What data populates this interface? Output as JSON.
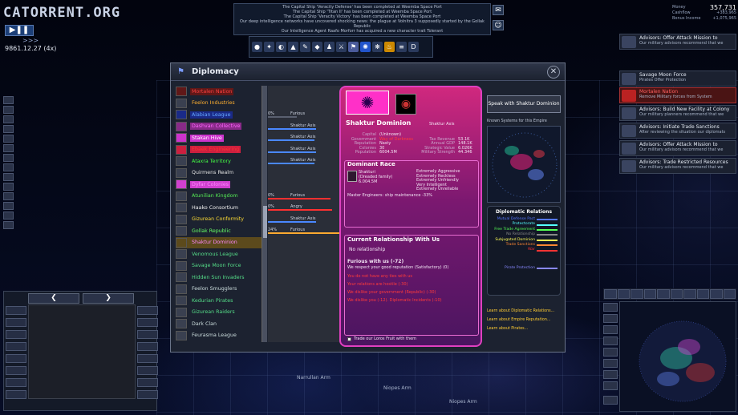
{
  "app": {
    "logo": "CATORRENT.ORG",
    "play_pause": "▶❚❚",
    "speed_arrows": ">>>",
    "game_date": "9861.12.27 (4x)"
  },
  "messages": [
    "The Capital Ship 'Veracity Defense' has been completed at Weemba Space Port",
    "The Capital Ship 'Titan II' has been completed at Weemba Space Port",
    "The Capital Ship 'Veracity Victory' has been completed at Weemba Space Port",
    "Our deep intelligence networks have uncovered shocking news: the plague at Volnitra 3 supposedly started by the Gollak Republic",
    "Our Intelligence Agent Raafo Morforr has acquired a new character trait Tolerant"
  ],
  "top_stats": {
    "money_label": "Money",
    "money": "357,731",
    "cashflow_label": "Cashflow",
    "cashflow": "+383,965",
    "bonus_label": "Bonus Income",
    "bonus": "+1,075,965"
  },
  "advisors": [
    {
      "title": "Advisors: Offer Attack Mission to",
      "sub": "Our military advisors recommend that we",
      "red": false
    },
    {
      "title": "Savage Moon Force",
      "sub": "Pirates Offer Protection",
      "red": false
    },
    {
      "title": "Mortalen Nation",
      "sub": "Remove Military forces from System",
      "red": true
    },
    {
      "title": "Advisors: Build New Facility at Colony",
      "sub": "Our military planners recommend that we",
      "red": false
    },
    {
      "title": "Advisors: Initiate Trade Sanctions",
      "sub": "After reviewing the situation our diplomats",
      "red": false
    },
    {
      "title": "Advisors: Offer Attack Mission to",
      "sub": "Our military advisors recommend that we",
      "red": false
    },
    {
      "title": "Advisors: Trade Restricted Resources",
      "sub": "Our military advisors recommend that we",
      "red": false
    }
  ],
  "dialog": {
    "title": "Diplomacy",
    "close_icon": "close-icon"
  },
  "empires": [
    {
      "name": "Mortalen Nation",
      "color": "#ff4040",
      "bg": "#601818"
    },
    {
      "name": "Feelon Industries",
      "color": "#ffb030",
      "bg": ""
    },
    {
      "name": "Alabian League",
      "color": "#66aaff",
      "bg": "#1a2a88"
    },
    {
      "name": "Dashvan Collective",
      "color": "#ff66ff",
      "bg": "#882a88"
    },
    {
      "name": "Stakan Hive",
      "color": "#ffffff",
      "bg": "#cc33cc"
    },
    {
      "name": "Ebaek Engineering",
      "color": "#ff3333",
      "bg": "#cc1f3f"
    },
    {
      "name": "Ataxra Territory",
      "color": "#44ff44",
      "bg": ""
    },
    {
      "name": "Quirmens Realm",
      "color": "#e0e0e0",
      "bg": ""
    },
    {
      "name": "Dyfar Colonies",
      "color": "#ff88ff",
      "bg": "#d040d0"
    },
    {
      "name": "Atunilian Kingdom",
      "color": "#55ee55",
      "bg": ""
    },
    {
      "name": "Haako Consortium",
      "color": "#f0f0f0",
      "bg": ""
    },
    {
      "name": "Gizurean Conformity",
      "color": "#ffdd33",
      "bg": ""
    },
    {
      "name": "Gollak Republic",
      "color": "#66ff66",
      "bg": ""
    },
    {
      "name": "Shaktur Dominion",
      "color": "#ff88ff",
      "bg": "#5c4a1c"
    },
    {
      "name": "Venomous League",
      "color": "#55dd88",
      "bg": ""
    },
    {
      "name": "Savage Moon Force",
      "color": "#55dd88",
      "bg": ""
    },
    {
      "name": "Hidden Sun Invaders",
      "color": "#55dd88",
      "bg": ""
    },
    {
      "name": "Feelon Smugglers",
      "color": "#ccdddd",
      "bg": ""
    },
    {
      "name": "Kedurian Pirates",
      "color": "#55dd88",
      "bg": ""
    },
    {
      "name": "Gizurean Raiders",
      "color": "#55dd88",
      "bg": ""
    },
    {
      "name": "Dark Clan",
      "color": "#ccdddd",
      "bg": ""
    },
    {
      "name": "Feurasma League",
      "color": "#ccdddd",
      "bg": ""
    }
  ],
  "relations_col": [
    {
      "label": "Furious",
      "value": "0%",
      "bar": "#5a6070"
    },
    {
      "label": "Shaktur Axis",
      "value": "",
      "bar": "#4a88ff"
    },
    {
      "label": "Shaktur Axis",
      "value": "",
      "bar": "#4a88ff"
    },
    {
      "label": "Shaktur Axis",
      "value": "",
      "bar": "#4a88ff"
    },
    {
      "label": "Shaktur Axis",
      "value": "",
      "bar": "#4a88ff"
    },
    {
      "label": "Furious",
      "value": "0%",
      "bar": "#ff3030"
    },
    {
      "label": "Angry",
      "value": "0%",
      "bar": "#ff3030"
    },
    {
      "label": "Shaktur Axis",
      "value": "",
      "bar": "#4a88ff"
    },
    {
      "label": "Furious",
      "value": "24%",
      "bar": "#ffaa30"
    }
  ],
  "selected": {
    "name": "Shaktur Dominion",
    "axis": "Shaktur Axis",
    "capital_label": "Capital",
    "capital": "(Unknown)",
    "government_label": "Government",
    "government": "Way of Darkness",
    "reputation_label": "Reputation",
    "reputation": "Nasty",
    "colonies_label": "Colonies",
    "colonies": "30",
    "population_label": "Population",
    "population": "6004.5M",
    "tax_label": "Tax Revenue",
    "tax": "53.1K",
    "gdp_label": "Annual GDP",
    "gdp": "148.1K",
    "strategic_label": "Strategic Value",
    "strategic": "6.026K",
    "military_label": "Military Strength",
    "military": "44.346",
    "race_header": "Dominant Race",
    "race": "Shakturi",
    "race_sub": "(Dreaded family)",
    "race_pop": "6.004.5M",
    "traits": [
      "Extremely Aggressive",
      "Extremely Reckless",
      "Extremely Unfriendly",
      "Very Intelligent",
      "Extremely Unreliable"
    ],
    "race_bonus": "Master Engineers: ship maintenance -33%",
    "relationship_header": "Current Relationship With Us",
    "relationship": "No relationship",
    "feeling": "Furious with us (-72)",
    "reasons": [
      "We respect your good reputation (Satisfactory) (0)",
      "You do not have any ties with us",
      "Your relations are hostile (-30)",
      "We dislike your government (Republic) (-30)",
      "We dislike you (-12). Diplomatic Incidents (-10)"
    ],
    "trade_label": "Trade our Loros Fruit with them"
  },
  "right_panel": {
    "speak_button": "Speak with Shaktur Dominion",
    "known_systems": "Known Systems for this Empire",
    "legend_title": "Diplomatic Relations",
    "legend": [
      {
        "label": "Mutual Defense Pact",
        "color": "#5577ff"
      },
      {
        "label": "Protectorate",
        "color": "#55ffff"
      },
      {
        "label": "Free Trade Agreement",
        "color": "#55ff55"
      },
      {
        "label": "No Relationship",
        "color": "#888888"
      },
      {
        "label": "Subjugated Dominion",
        "color": "#ffff55"
      },
      {
        "label": "Trade Sanctions",
        "color": "#ff8833"
      },
      {
        "label": "War",
        "color": "#ff3333"
      },
      {
        "label": "Pirate Protection",
        "color": "#8888ff"
      }
    ],
    "learn_links": [
      "Learn about Diplomatic Relations...",
      "Learn about Empire Reputation...",
      "Learn about Pirates..."
    ]
  },
  "map_labels": [
    "Narrullan Arm",
    "Niopes Arm",
    "Niopes Arm"
  ]
}
